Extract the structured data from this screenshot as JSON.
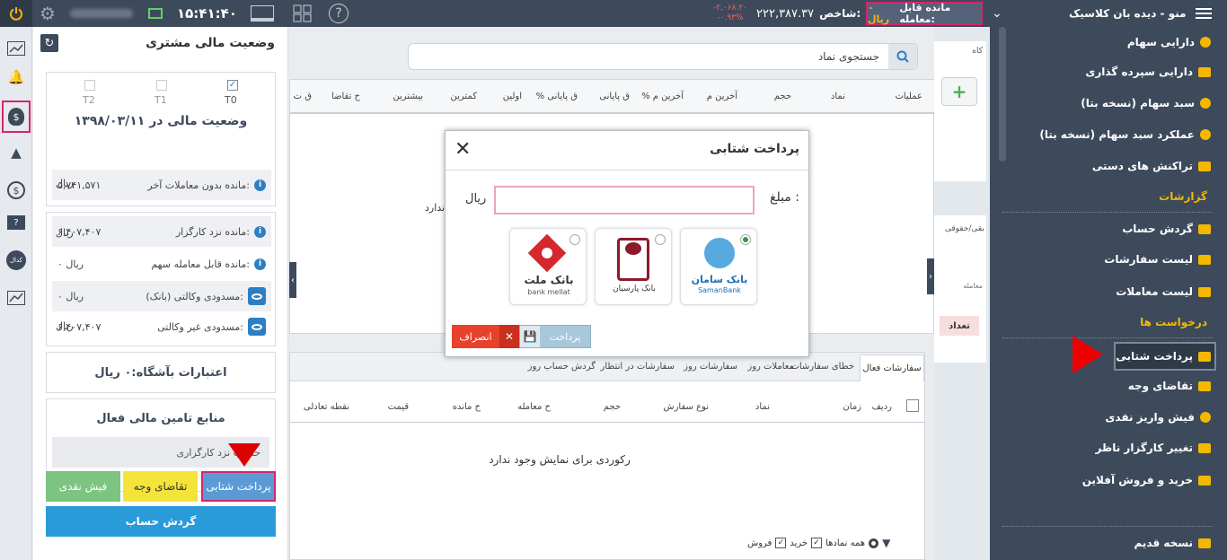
{
  "topbar": {
    "menu_title": "منو - دیده بان کلاسیک",
    "tradable_label": "مانده قابل معامله:",
    "tradable_value": "۰ ریال",
    "index_label": "شاخص:",
    "index_value": "۲۲۲,۳۸۷.۳۷",
    "index_change": "-۲,۰۶۸.۲۰",
    "index_pct": "-۰.۹۳%",
    "clock": "۱۵:۴۱:۴۰"
  },
  "panel": {
    "title": "وضعیت مالی مشتری",
    "t0": "T0",
    "t1": "T1",
    "t2": "T2",
    "status_title": "وضعیت مالی در ۱۳۹۸/۰۳/۱۱",
    "rows": [
      {
        "label": "مانده بدون معاملات آخر:",
        "value": "۵,۷۴۱,۵۷۱"
      },
      {
        "label": "مانده نزد کارگزار:",
        "value": "۶,۴۰۷,۴۰۷"
      },
      {
        "label": "مانده قابل معامله سهم:",
        "value": "۰ ریال"
      },
      {
        "label": "مسدودی وکالتی (بانک):",
        "value": "۰ ریال"
      },
      {
        "label": "مسدودی غیر وکالتی:",
        "value": "۶,۴۰۷,۴۰۷"
      }
    ],
    "rial": "ریال",
    "credit": "اعتبارات بآشگاه:۰ ریال",
    "funding_title": "منابع تامین مالی فعال",
    "funding_item": "حساب نزد کارگزاری",
    "btn_online": "پرداخت شتابی",
    "btn_withdraw": "تقاضای وجه",
    "btn_cash": "فیش نقدی",
    "btn_turnover": "گردش حساب"
  },
  "main": {
    "search_placeholder": "جستجوی نماد",
    "top_headers": [
      "عملیات",
      "نماد",
      "حجم",
      "آخرین م",
      "% آخرین م",
      "ق پایانی",
      "% ق پایانی",
      "اولین",
      "کمترین",
      "بیشترین",
      "ح تقاضا",
      "ق ت"
    ],
    "partial_text": "ندارد",
    "tabs": [
      "سفارشات فعال",
      "خطای سفارشات",
      "معاملات روز",
      "سفارشات روز",
      "سفارشات در انتظار",
      "گردش حساب روز"
    ],
    "bottom_headers": [
      "ردیف",
      "زمان",
      "نماد",
      "نوع سفارش",
      "حجم",
      "ح معامله",
      "ح مانده",
      "قیمت",
      "نقطه تعادلی"
    ],
    "empty": "رکوردی برای نمایش وجود ندارد",
    "filter_all": "همه نمادها",
    "filter_buy": "خرید",
    "filter_sell": "فروش",
    "right_partial": [
      "کاه",
      "بقی/حقوقی",
      "معامله",
      "تعداد"
    ]
  },
  "modal": {
    "title": "پرداخت شتابی",
    "amount_label": "مبلغ :",
    "currency": "ریال",
    "pay": "پرداخت",
    "cancel": "انصراف",
    "banks": [
      {
        "name": "بانک سامان",
        "sub": "SamanBank"
      },
      {
        "name": "بانک پارسیان",
        "sub": ""
      },
      {
        "name": "بانک ملت",
        "sub": "bank mellat"
      }
    ]
  },
  "sidebar": {
    "items1": [
      "دارایی سهام",
      "دارایی سپرده گذاری",
      "سبد سهام (نسخه بتا)",
      "عملکرد سبد سهام (نسخه بتا)",
      "تراکنش های دستی"
    ],
    "sec_reports": "گزارشات",
    "items2": [
      "گردش حساب",
      "لیست سفارشات",
      "لیست معاملات"
    ],
    "sec_requests": "درخواست ها",
    "items3": [
      "پرداخت شتابی",
      "تقاضای وجه",
      "فیش واریز نقدی",
      "تغییر کارگزار ناظر",
      "خرید و فروش آفلاین"
    ],
    "old_version": "نسخه قدیم"
  },
  "colors": {
    "accent": "#f5b800",
    "brand": "#3d4a5c",
    "highlight": "#d4266d",
    "blue": "#2c7fc2"
  }
}
